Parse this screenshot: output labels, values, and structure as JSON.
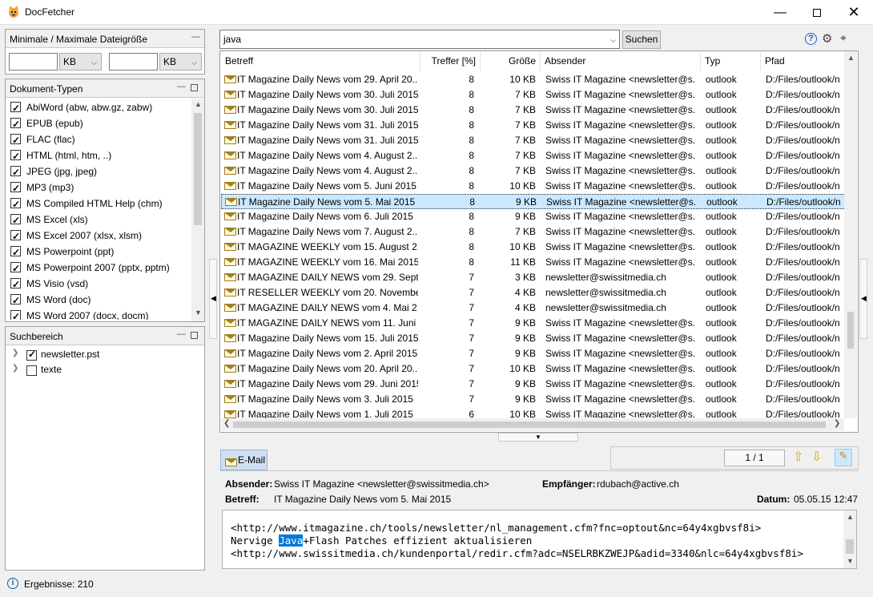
{
  "window": {
    "title": "DocFetcher"
  },
  "left": {
    "size_panel": {
      "title": "Minimale / Maximale Dateigröße",
      "min_value": "",
      "max_value": "",
      "min_unit": "KB",
      "max_unit": "KB"
    },
    "types_panel": {
      "title": "Dokument-Typen",
      "items": [
        {
          "label": "AbiWord (abw, abw.gz, zabw)",
          "checked": true
        },
        {
          "label": "EPUB (epub)",
          "checked": true
        },
        {
          "label": "FLAC (flac)",
          "checked": true
        },
        {
          "label": "HTML (html, htm, ..)",
          "checked": true
        },
        {
          "label": "JPEG (jpg, jpeg)",
          "checked": true
        },
        {
          "label": "MP3 (mp3)",
          "checked": true
        },
        {
          "label": "MS Compiled HTML Help (chm)",
          "checked": true
        },
        {
          "label": "MS Excel (xls)",
          "checked": true
        },
        {
          "label": "MS Excel 2007 (xlsx, xlsm)",
          "checked": true
        },
        {
          "label": "MS Powerpoint (ppt)",
          "checked": true
        },
        {
          "label": "MS Powerpoint 2007 (pptx, pptm)",
          "checked": true
        },
        {
          "label": "MS Visio (vsd)",
          "checked": true
        },
        {
          "label": "MS Word (doc)",
          "checked": true
        },
        {
          "label": "MS Word 2007 (docx, docm)",
          "checked": true
        }
      ]
    },
    "scope_panel": {
      "title": "Suchbereich",
      "items": [
        {
          "label": "newsletter.pst",
          "checked": true
        },
        {
          "label": "texte",
          "checked": false
        }
      ]
    }
  },
  "search": {
    "query": "java",
    "button": "Suchen"
  },
  "table": {
    "columns": [
      "Betreff",
      "Treffer [%]",
      "Größe",
      "Absender",
      "Typ",
      "Pfad"
    ],
    "rows": [
      [
        "IT Magazine Daily News vom 29. April 20...",
        "8",
        "10 KB",
        "Swiss IT Magazine <newsletter@s...",
        "outlook",
        "D:/Files/outlook/n"
      ],
      [
        "IT Magazine Daily News vom 30. Juli 2015",
        "8",
        "7 KB",
        "Swiss IT Magazine <newsletter@s...",
        "outlook",
        "D:/Files/outlook/n"
      ],
      [
        "IT Magazine Daily News vom 30. Juli 2015",
        "8",
        "7 KB",
        "Swiss IT Magazine <newsletter@s...",
        "outlook",
        "D:/Files/outlook/n"
      ],
      [
        "IT Magazine Daily News vom 31. Juli 2015",
        "8",
        "7 KB",
        "Swiss IT Magazine <newsletter@s...",
        "outlook",
        "D:/Files/outlook/n"
      ],
      [
        "IT Magazine Daily News vom 31. Juli 2015",
        "8",
        "7 KB",
        "Swiss IT Magazine <newsletter@s...",
        "outlook",
        "D:/Files/outlook/n"
      ],
      [
        "IT Magazine Daily News vom 4. August 2...",
        "8",
        "7 KB",
        "Swiss IT Magazine <newsletter@s...",
        "outlook",
        "D:/Files/outlook/n"
      ],
      [
        "IT Magazine Daily News vom 4. August 2...",
        "8",
        "7 KB",
        "Swiss IT Magazine <newsletter@s...",
        "outlook",
        "D:/Files/outlook/n"
      ],
      [
        "IT Magazine Daily News vom 5. Juni 2015",
        "8",
        "10 KB",
        "Swiss IT Magazine <newsletter@s...",
        "outlook",
        "D:/Files/outlook/n"
      ],
      [
        "IT Magazine Daily News vom 5. Mai 2015",
        "8",
        "9 KB",
        "Swiss IT Magazine <newsletter@s...",
        "outlook",
        "D:/Files/outlook/n"
      ],
      [
        "IT Magazine Daily News vom 6. Juli 2015",
        "8",
        "9 KB",
        "Swiss IT Magazine <newsletter@s...",
        "outlook",
        "D:/Files/outlook/n"
      ],
      [
        "IT Magazine Daily News vom 7. August 2...",
        "8",
        "7 KB",
        "Swiss IT Magazine <newsletter@s...",
        "outlook",
        "D:/Files/outlook/n"
      ],
      [
        "IT MAGAZINE WEEKLY vom 15. August 2...",
        "8",
        "10 KB",
        "Swiss IT Magazine <newsletter@s...",
        "outlook",
        "D:/Files/outlook/n"
      ],
      [
        "IT MAGAZINE WEEKLY vom 16. Mai 2015...",
        "8",
        "11 KB",
        "Swiss IT Magazine <newsletter@s...",
        "outlook",
        "D:/Files/outlook/n"
      ],
      [
        "IT MAGAZINE DAILY NEWS vom 29. Sept...",
        "7",
        "3 KB",
        "newsletter@swissitmedia.ch",
        "outlook",
        "D:/Files/outlook/n"
      ],
      [
        "IT RESELLER WEEKLY vom 20. November ...",
        "7",
        "4 KB",
        "newsletter@swissitmedia.ch",
        "outlook",
        "D:/Files/outlook/n"
      ],
      [
        "IT MAGAZINE DAILY NEWS vom 4. Mai 2...",
        "7",
        "4 KB",
        "newsletter@swissitmedia.ch",
        "outlook",
        "D:/Files/outlook/n"
      ],
      [
        "IT MAGAZINE DAILY NEWS vom 11. Juni ...",
        "7",
        "9 KB",
        "Swiss IT Magazine <newsletter@s...",
        "outlook",
        "D:/Files/outlook/n"
      ],
      [
        "IT Magazine Daily News vom 15. Juli 2015",
        "7",
        "9 KB",
        "Swiss IT Magazine <newsletter@s...",
        "outlook",
        "D:/Files/outlook/n"
      ],
      [
        "IT Magazine Daily News vom 2. April 2015",
        "7",
        "9 KB",
        "Swiss IT Magazine <newsletter@s...",
        "outlook",
        "D:/Files/outlook/n"
      ],
      [
        "IT Magazine Daily News vom 20. April 20...",
        "7",
        "10 KB",
        "Swiss IT Magazine <newsletter@s...",
        "outlook",
        "D:/Files/outlook/n"
      ],
      [
        "IT Magazine Daily News vom 29. Juni 2015",
        "7",
        "9 KB",
        "Swiss IT Magazine <newsletter@s...",
        "outlook",
        "D:/Files/outlook/n"
      ],
      [
        "IT Magazine Daily News vom 3. Juli 2015",
        "7",
        "9 KB",
        "Swiss IT Magazine <newsletter@s...",
        "outlook",
        "D:/Files/outlook/n"
      ],
      [
        "IT Magazine Daily News vom 1. Juli 2015",
        "6",
        "10 KB",
        "Swiss IT Magazine <newsletter@s...",
        "outlook",
        "D:/Files/outlook/n"
      ]
    ],
    "selected_row": 8
  },
  "preview": {
    "tab": "E-Mail",
    "page_indicator": "1 / 1",
    "sender_label": "Absender:",
    "sender": "Swiss IT Magazine <newsletter@swissitmedia.ch>",
    "recipient_label": "Empfänger:",
    "recipient": "rdubach@active.ch",
    "subject_label": "Betreff:",
    "subject": "IT Magazine Daily News vom 5. Mai 2015",
    "date_label": "Datum:",
    "date": "05.05.15 12:47",
    "body_line1": "<http://www.itmagazine.ch/tools/newsletter/nl_management.cfm?fnc=optout&nc=64y4xgbvsf8i>",
    "body_line2_pre": "Nervige ",
    "body_line2_hl": "Java",
    "body_line2_post": "+Flash Patches effizient aktualisieren",
    "body_line3": "<http://www.swissitmedia.ch/kundenportal/redir.cfm?adc=NSELRBKZWEJP&adid=3340&nlc=64y4xgbvsf8i>"
  },
  "status": {
    "text": "Ergebnisse: 210"
  }
}
